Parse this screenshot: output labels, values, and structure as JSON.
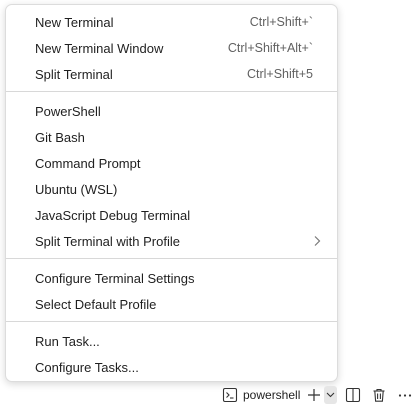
{
  "menu": {
    "groups": [
      [
        {
          "label": "New Terminal",
          "shortcut": "Ctrl+Shift+`"
        },
        {
          "label": "New Terminal Window",
          "shortcut": "Ctrl+Shift+Alt+`"
        },
        {
          "label": "Split Terminal",
          "shortcut": "Ctrl+Shift+5"
        }
      ],
      [
        {
          "label": "PowerShell"
        },
        {
          "label": "Git Bash"
        },
        {
          "label": "Command Prompt"
        },
        {
          "label": "Ubuntu (WSL)"
        },
        {
          "label": "JavaScript Debug Terminal"
        },
        {
          "label": "Split Terminal with Profile",
          "submenu": true
        }
      ],
      [
        {
          "label": "Configure Terminal Settings"
        },
        {
          "label": "Select Default Profile"
        }
      ],
      [
        {
          "label": "Run Task..."
        },
        {
          "label": "Configure Tasks..."
        }
      ]
    ]
  },
  "bottom_bar": {
    "terminal_tab_label": "powershell",
    "icons": {
      "terminal": "terminal-icon",
      "add": "plus-icon",
      "dropdown": "chevron-down-icon",
      "split": "split-icon",
      "kill": "trash-icon",
      "more": "more-icon"
    }
  },
  "colors": {
    "text": "#1f1f1f",
    "shortcut": "#616161",
    "separator": "#d8d8d8",
    "menu_border": "#dcdcdc"
  }
}
